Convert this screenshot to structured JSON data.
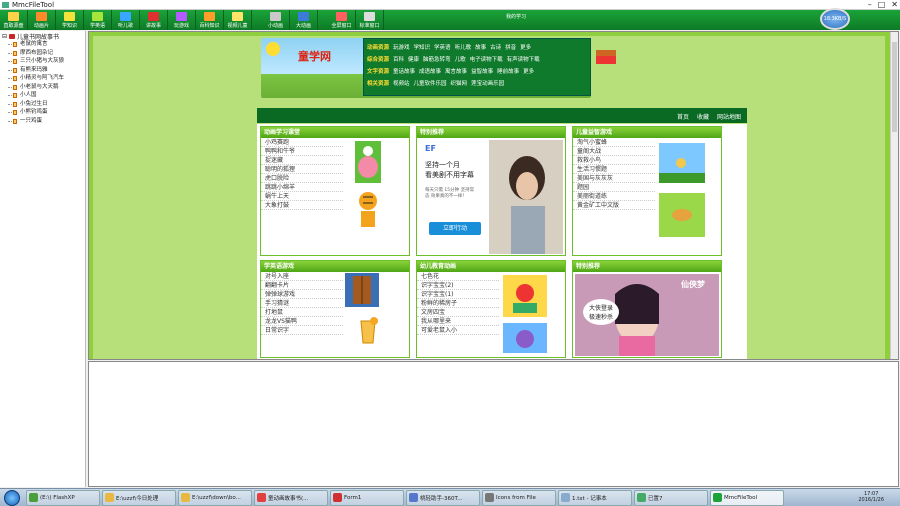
{
  "window": {
    "title": "MmcFileTool",
    "min": "–",
    "max": "□",
    "close": "✕"
  },
  "toolbar": {
    "buttons": [
      {
        "label": "直取源盘",
        "color": "#ffd24a"
      },
      {
        "label": "动画片",
        "color": "#ff8a2a"
      },
      {
        "label": "学知识",
        "color": "#f3e23a"
      },
      {
        "label": "学英语",
        "color": "#a6e53c"
      },
      {
        "label": "听儿歌",
        "color": "#3aa7ff"
      },
      {
        "label": "讲故事",
        "color": "#e03030"
      },
      {
        "label": "玩游戏",
        "color": "#b35cff"
      },
      {
        "label": "百科知识",
        "color": "#ff9f2a"
      },
      {
        "label": "视频儿童",
        "color": "#ffe46a"
      },
      {
        "label": "小动画",
        "color": "#c9c9c9"
      },
      {
        "label": "大动画",
        "color": "#3c7bd9"
      },
      {
        "label": "全屏窗口",
        "color": "#ff6060"
      },
      {
        "label": "标准窗口",
        "color": "#dddddd"
      }
    ],
    "extra_label": "我的学习",
    "speed": "18.3KB/S"
  },
  "tree": {
    "root": "儿童书网故事书",
    "items": [
      "老鼠的寓言",
      "摩西布园杂记",
      "三只小猪与大灰狼",
      "有熊来玛雅",
      "小精灵与阿飞汽车",
      "小老鼠与大天鹅",
      "小人国",
      "小兔过生日",
      "小熊钓鸡蛋",
      "一只鸡蛋"
    ]
  },
  "site": {
    "logo": "童学网",
    "nav": [
      {
        "cat": "动画资源",
        "links": [
          "玩游戏",
          "学知识",
          "学英语",
          "听儿歌",
          "故事",
          "古诗",
          "拼音",
          "更多"
        ]
      },
      {
        "cat": "综合资源",
        "links": [
          "百科",
          "健康",
          "脑筋急转弯",
          "儿歌",
          "电子读物下载",
          "有声读物下载"
        ]
      },
      {
        "cat": "文字资源",
        "links": [
          "童话故事",
          "成语故事",
          "寓言故事",
          "益智故事",
          "睡前故事",
          "更多"
        ]
      },
      {
        "cat": "相关资源",
        "links": [
          "视频站",
          "儿童软件乐园",
          "织猫网",
          "莲宝动画乐园"
        ]
      }
    ],
    "top_links": [
      "首页",
      "收藏",
      "网站地图"
    ],
    "boxes": {
      "anim": {
        "title": "动画学习课堂",
        "items": [
          "小鸡赛跑",
          "鸭鸭和牛爷",
          "捉迷藏",
          "聪明的狐狸",
          "虎口脱险",
          "跳跳小绵羊",
          "蜗牛上天",
          "大象打鼓"
        ]
      },
      "special1": {
        "title": "特别推荐",
        "ad_brand": "EF",
        "ad_line1": "坚持一个月",
        "ad_line2": "看美剧不用字幕",
        "ad_small": "每天只需 15分钟 坚持常态 效果真的不一样！",
        "ad_button": "立即行动"
      },
      "puzzle": {
        "title": "儿童益智游戏",
        "items": [
          "淘气小蜜蜂",
          "童阁大战",
          "救救小鸟",
          "生活习惯题",
          "美国与灰灰灰",
          "题园",
          "美丽街道练",
          "黄金矿工中文版"
        ]
      },
      "english": {
        "title": "学英语游戏",
        "items": [
          "对号入座",
          "翻翻卡片",
          "弹弹球游戏",
          "手习猜谜",
          "打地鼠",
          "龙龙VS猫鸭",
          "日常识字"
        ]
      },
      "kids": {
        "title": "幼儿教育动画",
        "items": [
          "七色花",
          "识字宝宝(2)",
          "识字宝宝(1)",
          "粉鲜的稀房子",
          "文房四宝",
          "我从哪里来",
          "可爱老鼠入小"
        ]
      },
      "special2": {
        "title": "特别推荐",
        "ad_text": "大侠登录 极速秒杀",
        "ad_brand2": "仙侠梦"
      }
    }
  },
  "taskbar": {
    "tasks": [
      {
        "label": "(E:\\) FlashXP",
        "color": "#4a9f3a"
      },
      {
        "label": "E:\\uzzf\\今日处理",
        "color": "#e8b840"
      },
      {
        "label": "E:\\uzzf\\down\\bo...",
        "color": "#e8b840"
      },
      {
        "label": "童动画故事书(...",
        "color": "#e04040"
      },
      {
        "label": "Form1",
        "color": "#d03030"
      },
      {
        "label": "桃轻助手-360T...",
        "color": "#5577cc"
      },
      {
        "label": "Icons from File",
        "color": "#777777"
      },
      {
        "label": "1.txt - 记事本",
        "color": "#88aacc"
      },
      {
        "label": "已置7",
        "color": "#44aa66"
      },
      {
        "label": "MmcFileTool",
        "color": "#1ba33a"
      }
    ],
    "time": "17:07",
    "date": "2016/1/26"
  }
}
